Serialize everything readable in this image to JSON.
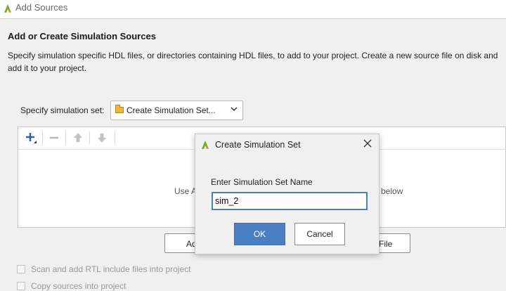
{
  "window": {
    "title": "Add Sources",
    "icon": "vivado-logo-icon"
  },
  "page": {
    "heading": "Add or Create Simulation Sources",
    "description": "Specify simulation specific HDL files, or directories containing HDL files, to add to your project. Create a new source file on disk and add it to your project."
  },
  "simulation_set": {
    "label": "Specify simulation set:",
    "selected": "Create Simulation Set...",
    "icon": "folder-icon"
  },
  "file_toolbar": {
    "buttons": [
      "add-icon",
      "remove-icon",
      "move-up-icon",
      "move-down-icon"
    ]
  },
  "file_panel": {
    "hint_left": "Use A",
    "hint_right": "below"
  },
  "actions": {
    "add_files_fragment": "Ad",
    "create_file_fragment": "File"
  },
  "options": {
    "scan_rtl": "Scan and add RTL include files into project",
    "copy_sources": "Copy sources into project"
  },
  "dialog": {
    "title": "Create Simulation Set",
    "label": "Enter Simulation Set Name",
    "value": "sim_2",
    "ok": "OK",
    "cancel": "Cancel"
  },
  "colors": {
    "accent": "#4a7fc1",
    "logo_green": "#7aa62a",
    "logo_orange": "#e8a23a"
  }
}
